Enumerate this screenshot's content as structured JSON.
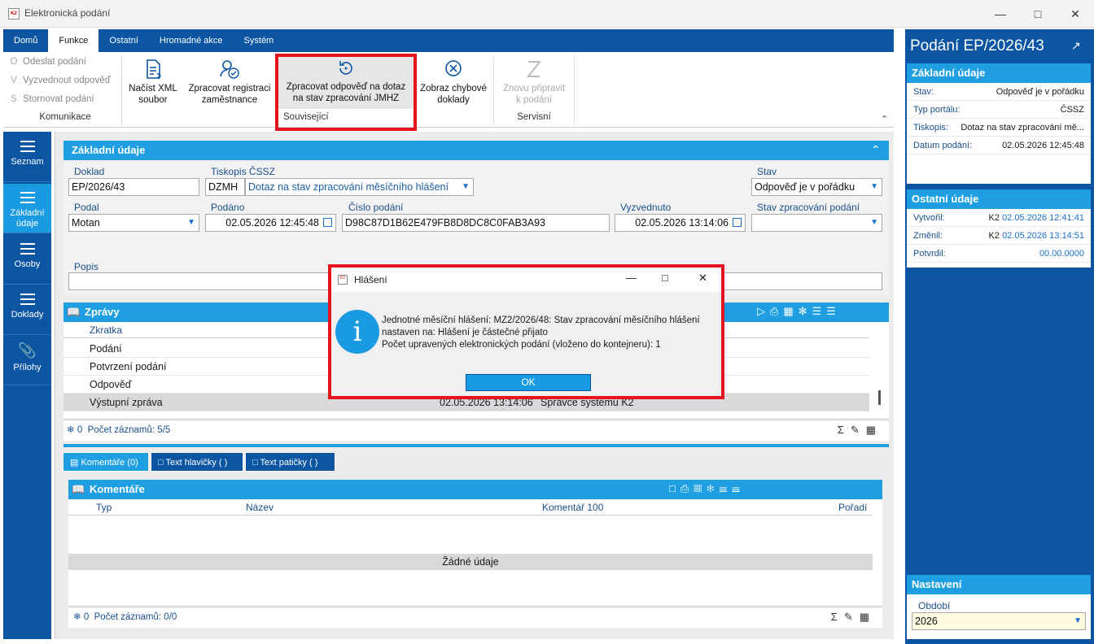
{
  "window": {
    "title": "Elektronická podání",
    "logo": "K2"
  },
  "menu": [
    "Domů",
    "Funkce",
    "Ostatní",
    "Hromadné akce",
    "Systém"
  ],
  "ribbon": {
    "small": [
      {
        "icon": "O",
        "label": "Odeslat podání"
      },
      {
        "icon": "V",
        "label": "Vyzvednout odpověď"
      },
      {
        "icon": "S",
        "label": "Stornovat podání"
      }
    ],
    "groups": {
      "komunikace": "Komunikace",
      "souvisejici": "Související",
      "servisni": "Servisní"
    },
    "btn1": {
      "l1": "Načíst XML",
      "l2": "soubor"
    },
    "btn2": {
      "l1": "Zpracovat registraci",
      "l2": "zaměstnance"
    },
    "btn3": {
      "l1": "Zpracovat odpověď na dotaz",
      "l2": "na stav zpracování JMHZ"
    },
    "btn4": {
      "l1": "Zobraz chybové",
      "l2": "doklady"
    },
    "btn5": {
      "l1": "Znovu připravit",
      "l2": "k podání"
    }
  },
  "leftnav": [
    "Seznam",
    "Základní údaje",
    "Osoby",
    "Doklady",
    "Přílohy"
  ],
  "form": {
    "header": "Základní údaje",
    "doklad_label": "Doklad",
    "doklad": "EP/2026/43",
    "tiskopis_label": "Tiskopis ČSSZ",
    "tiskopis_code": "DZMH",
    "tiskopis_name": "Dotaz na stav zpracování měsíčního hlášení",
    "stav_label": "Stav",
    "stav": "Odpověď je v pořádku",
    "podal_label": "Podal",
    "podal": "Motan",
    "podano_label": "Podáno",
    "podano": "02.05.2026 12:45:48",
    "cislo_label": "Číslo podání",
    "cislo": "D98C87D1B62E479FB8D8DC8C0FAB3A93",
    "vyzvednuto_label": "Vyzvednuto",
    "vyzvednuto": "02.05.2026 13:14:06",
    "stavzprac_label": "Stav zpracování podání",
    "stavzprac": "",
    "popis_label": "Popis",
    "popis": ""
  },
  "zpravy": {
    "header": "Zprávy",
    "col": "Zkratka",
    "rows": [
      "Podání",
      "Potvrzení podání",
      "Odpověď",
      "Výstupní zpráva"
    ],
    "last_row_date": "02.05.2026 13:14:06",
    "last_row_user": "Správce systému K2",
    "count": "0",
    "records": "Počet záznamů: 5/5"
  },
  "tabs": [
    "Komentáře (0)",
    "Text hlavičky ( )",
    "Text patičky ( )"
  ],
  "komentare": {
    "header": "Komentáře",
    "cols": [
      "Typ",
      "Název",
      "Komentář 100",
      "Pořadí"
    ],
    "empty": "Žádné údaje",
    "count": "0",
    "records": "Počet záznamů: 0/0"
  },
  "right": {
    "title": "Podání EP/2026/43",
    "zakladni": {
      "header": "Základní údaje",
      "rows": [
        [
          "Stav:",
          "Odpověď je v pořádku"
        ],
        [
          "Typ portálu:",
          "ČSSZ"
        ],
        [
          "Tiskopis:",
          "Dotaz na stav zpracování mě..."
        ],
        [
          "Datum podání:",
          "02.05.2026 12:45:48"
        ]
      ]
    },
    "ostatni": {
      "header": "Ostatní údaje",
      "rows": [
        [
          "Vytvořil:",
          "K2",
          "02.05.2026 12:41:41"
        ],
        [
          "Změnil:",
          "K2",
          "02.05.2026 13:14:51"
        ],
        [
          "Potvrdil:",
          "",
          "00.00.0000"
        ]
      ]
    },
    "nastaveni": {
      "header": "Nastavení",
      "label": "Období",
      "value": "2026"
    }
  },
  "dialog": {
    "title": "Hlášení",
    "line1": "Jednotné měsíční hlášení: MZ2/2026/48: Stav zpracování měsíčního hlášení",
    "line2": "nastaven na: Hlášení je částečné přijato",
    "line3": "Počet upravených elektronických podání (vloženo do kontejneru): 1",
    "ok": "OK"
  }
}
